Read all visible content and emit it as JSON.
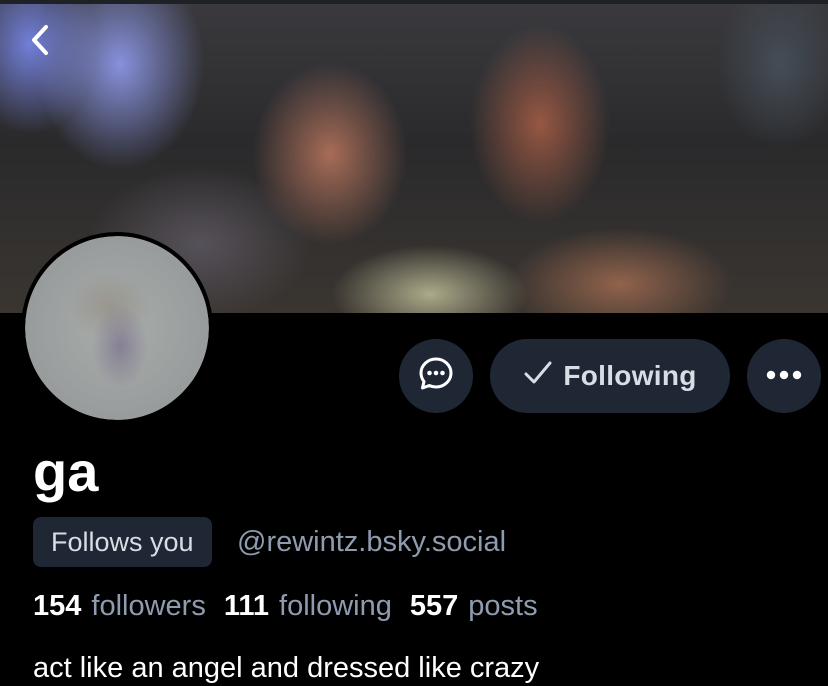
{
  "header": {
    "back_icon": "chevron-left-icon"
  },
  "profile": {
    "display_name": "ga",
    "follows_you_badge": "Follows you",
    "handle": "@rewintz.bsky.social",
    "bio": "act like an angel and dressed like crazy"
  },
  "actions": {
    "message_icon": "chat-bubble-icon",
    "following_label": "Following",
    "following_icon": "checkmark-icon",
    "more_icon": "ellipsis-icon"
  },
  "stats": [
    {
      "count": "154",
      "label": "followers"
    },
    {
      "count": "111",
      "label": "following"
    },
    {
      "count": "557",
      "label": "posts"
    }
  ],
  "colors": {
    "background": "#000000",
    "button_bg": "#1e2733",
    "muted_text": "#8f9cb0",
    "primary_text": "#ffffff"
  }
}
